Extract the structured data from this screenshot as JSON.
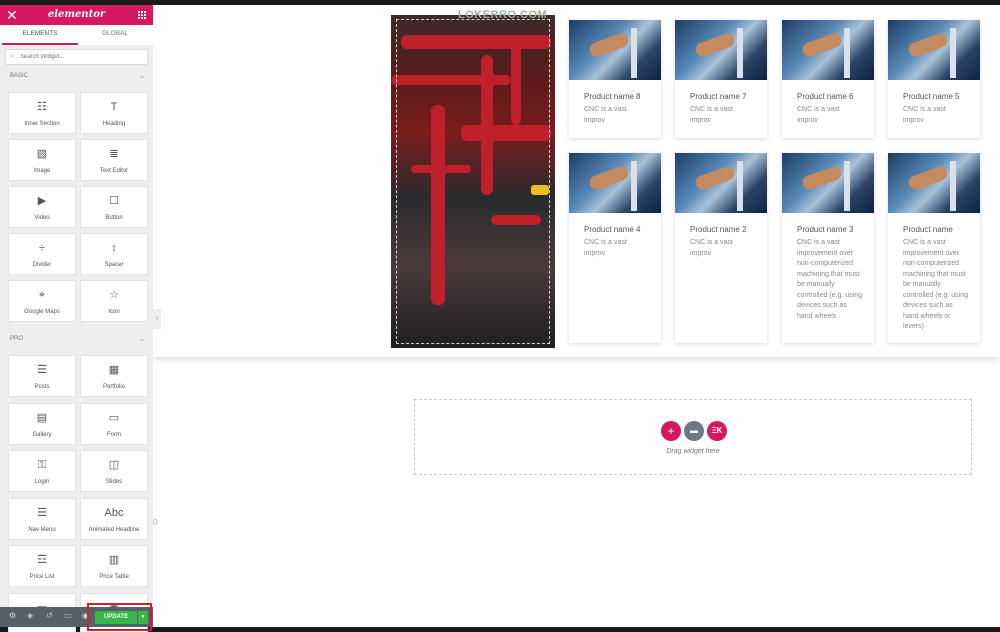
{
  "panel": {
    "logo": "elementor",
    "tabs": [
      "ELEMENTS",
      "GLOBAL"
    ],
    "search_placeholder": "Search Widget...",
    "categories": {
      "basic": "BASIC",
      "pro": "PRO"
    },
    "basic_widgets": [
      {
        "label": "Inner Section",
        "icon": "inner-section-icon",
        "glyph": "☷"
      },
      {
        "label": "Heading",
        "icon": "heading-icon",
        "glyph": "T"
      },
      {
        "label": "Image",
        "icon": "image-icon",
        "glyph": "▧"
      },
      {
        "label": "Text Editor",
        "icon": "text-editor-icon",
        "glyph": "≣"
      },
      {
        "label": "Video",
        "icon": "video-icon",
        "glyph": "▶"
      },
      {
        "label": "Button",
        "icon": "button-icon",
        "glyph": "☐"
      },
      {
        "label": "Divider",
        "icon": "divider-icon",
        "glyph": "÷"
      },
      {
        "label": "Spacer",
        "icon": "spacer-icon",
        "glyph": "↕"
      },
      {
        "label": "Google Maps",
        "icon": "google-maps-icon",
        "glyph": "⌖"
      },
      {
        "label": "Icon",
        "icon": "star-icon",
        "glyph": "☆"
      }
    ],
    "pro_widgets": [
      {
        "label": "Posts",
        "icon": "posts-icon",
        "glyph": "☰"
      },
      {
        "label": "Portfolio",
        "icon": "portfolio-icon",
        "glyph": "▦"
      },
      {
        "label": "Gallery",
        "icon": "gallery-icon",
        "glyph": "▤"
      },
      {
        "label": "Form",
        "icon": "form-icon",
        "glyph": "▭"
      },
      {
        "label": "Login",
        "icon": "login-icon",
        "glyph": "⚿"
      },
      {
        "label": "Slides",
        "icon": "slides-icon",
        "glyph": "◫"
      },
      {
        "label": "Nav Menu",
        "icon": "nav-menu-icon",
        "glyph": "☰"
      },
      {
        "label": "Animated Headline",
        "icon": "animated-headline-icon",
        "glyph": "Abc"
      },
      {
        "label": "Price List",
        "icon": "price-list-icon",
        "glyph": "☲"
      },
      {
        "label": "Price Table",
        "icon": "price-table-icon",
        "glyph": "▥"
      },
      {
        "label": "",
        "icon": "flip-box-icon",
        "glyph": "▭"
      },
      {
        "label": "",
        "icon": "call-to-action-icon",
        "glyph": "▣"
      }
    ],
    "footer": {
      "update_label": "UPDATE",
      "arrow": "▼"
    }
  },
  "canvas": {
    "watermark": "LOKERRO.COM",
    "products": [
      {
        "name": "Product name 8",
        "desc": "CNC is a vast improv"
      },
      {
        "name": "Product name 7",
        "desc": "CNC is a vast improv"
      },
      {
        "name": "Product name 6",
        "desc": "CNC is a vast improv"
      },
      {
        "name": "Product name 5",
        "desc": "CNC is a vast improv"
      },
      {
        "name": "Product name 4",
        "desc": "CNC is a vast improv"
      },
      {
        "name": "Product name 2",
        "desc": "CNC is a vast improv"
      },
      {
        "name": "Product name 3",
        "desc": "CNC is a vast improvement over non-computerized machining that must be manually controlled (e.g. using devices such as hand wheels"
      },
      {
        "name": "Product name",
        "desc": "CNC is a vast improvement over non-computerized machining that must be manually controlled (e.g. using devices such as hand wheels or levers)"
      }
    ],
    "drop_zone": {
      "text": "Drag widget here",
      "add": "+",
      "folder": "▬",
      "ek": "ΞK"
    },
    "stray_zero": "0",
    "colors": {
      "brand": "#d5185f",
      "update": "#39b54a",
      "highlight": "#d0202a"
    }
  }
}
